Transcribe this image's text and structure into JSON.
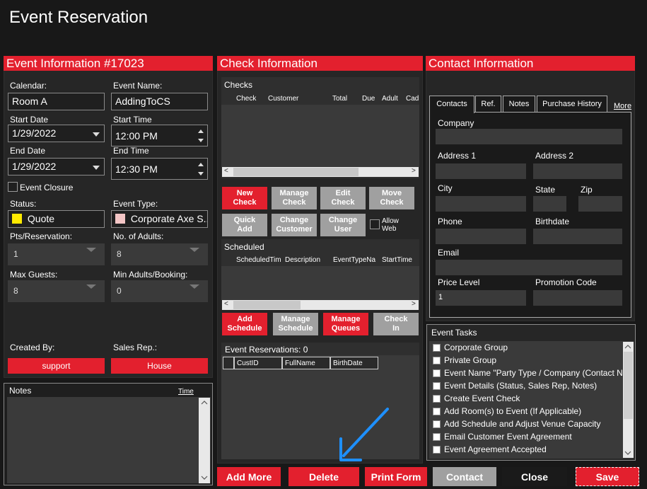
{
  "window": {
    "title": "Event Reservation"
  },
  "event_info": {
    "header": "Event Information #17023",
    "calendar_label": "Calendar:",
    "calendar_value": "Room A",
    "event_name_label": "Event Name:",
    "event_name_value": "AddingToCS",
    "start_date_label": "Start Date",
    "start_date_value": "1/29/2022",
    "start_time_label": "Start Time",
    "start_time_value": "12:00 PM",
    "end_date_label": "End Date",
    "end_date_value": "1/29/2022",
    "end_time_label": "End Time",
    "end_time_value": "12:30 PM",
    "event_closure_label": "Event Closure",
    "status_label": "Status:",
    "status_value": "Quote",
    "status_color": "#ffea00",
    "event_type_label": "Event Type:",
    "event_type_value": "Corporate Axe S...",
    "event_type_color": "#f4c6c6",
    "pts_label": "Pts/Reservation:",
    "pts_value": "1",
    "adults_label": "No. of Adults:",
    "adults_value": "8",
    "max_guests_label": "Max Guests:",
    "max_guests_value": "8",
    "min_adults_label": "Min Adults/Booking:",
    "min_adults_value": "0",
    "created_by_label": "Created By:",
    "created_by_value": "support",
    "sales_rep_label": "Sales Rep.:",
    "sales_rep_value": "House"
  },
  "notes": {
    "label": "Notes",
    "time_link": "Time"
  },
  "check_info": {
    "header": "Check Information",
    "checks_label": "Checks",
    "checks_columns": [
      "Check",
      "Customer",
      "Total",
      "Due",
      "Adult",
      "Cad"
    ],
    "buttons_row1": [
      "New\nCheck",
      "Manage\nCheck",
      "Edit\nCheck",
      "Move\nCheck"
    ],
    "buttons_row2": [
      "Quick\nAdd",
      "Change\nCustomer",
      "Change\nUser"
    ],
    "allow_web_label": "Allow\nWeb",
    "scheduled_label": "Scheduled",
    "scheduled_columns": [
      "ScheduledTim",
      "Description",
      "EventTypeNa",
      "StartTime"
    ],
    "sched_buttons": [
      "Add\nSchedule",
      "Manage\nSchedule",
      "Manage\nQueues",
      "Check\nIn"
    ],
    "reservations_label": "Event Reservations: 0",
    "reservations_columns": [
      "CustID",
      "FullName",
      "BirthDate"
    ]
  },
  "contact_info": {
    "header": "Contact Information",
    "tabs": [
      "Contacts",
      "Ref.",
      "Notes",
      "Purchase History"
    ],
    "more_link": "More",
    "company_label": "Company",
    "address1_label": "Address 1",
    "address2_label": "Address 2",
    "city_label": "City",
    "state_label": "State",
    "zip_label": "Zip",
    "phone_label": "Phone",
    "birthdate_label": "Birthdate",
    "email_label": "Email",
    "price_level_label": "Price Level",
    "price_level_value": "1",
    "promo_label": "Promotion Code"
  },
  "event_tasks": {
    "label": "Event Tasks",
    "items": [
      "Corporate Group",
      "Private Group",
      "Event Name \"Party Type / Company (Contact Na",
      "Event Details (Status, Sales Rep, Notes)",
      "Create Event Check",
      "Add Room(s) to Event (If Applicable)",
      "Add Schedule and Adjust Venue Capacity",
      "Email Customer Event Agreement",
      "Event Agreement Accepted"
    ]
  },
  "footer": {
    "add_more": "Add More",
    "delete": "Delete",
    "print_form": "Print Form",
    "contact": "Contact",
    "close": "Close",
    "save": "Save"
  },
  "colors": {
    "accent": "#e3202e",
    "arrow": "#1e90ff"
  }
}
